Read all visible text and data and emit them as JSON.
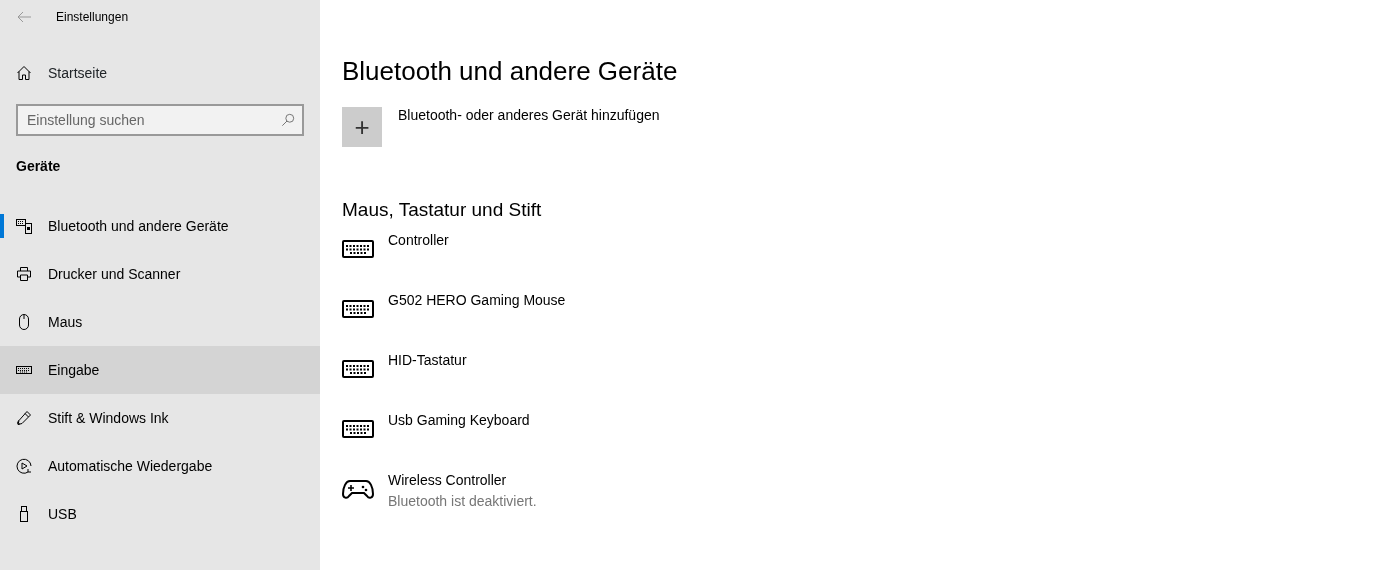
{
  "window": {
    "title": "Einstellungen"
  },
  "sidebar": {
    "home": "Startseite",
    "search": {
      "placeholder": "Einstellung suchen"
    },
    "section": "Geräte",
    "items": [
      {
        "label": "Bluetooth und andere Geräte",
        "kind": "bluetooth",
        "selected": true,
        "hovered": false
      },
      {
        "label": "Drucker und Scanner",
        "kind": "printer",
        "selected": false,
        "hovered": false
      },
      {
        "label": "Maus",
        "kind": "mouse",
        "selected": false,
        "hovered": false
      },
      {
        "label": "Eingabe",
        "kind": "keyboard",
        "selected": false,
        "hovered": true
      },
      {
        "label": "Stift & Windows Ink",
        "kind": "pen",
        "selected": false,
        "hovered": false
      },
      {
        "label": "Automatische Wiedergabe",
        "kind": "autoplay",
        "selected": false,
        "hovered": false
      },
      {
        "label": "USB",
        "kind": "usb",
        "selected": false,
        "hovered": false
      }
    ]
  },
  "page": {
    "title": "Bluetooth und andere Geräte",
    "add_button": {
      "label": "Bluetooth- oder anderes Gerät hinzufügen",
      "icon": "+"
    },
    "section": "Maus, Tastatur und Stift",
    "devices": [
      {
        "name": "Controller",
        "kind": "keyboard"
      },
      {
        "name": "G502 HERO Gaming Mouse",
        "kind": "keyboard"
      },
      {
        "name": "HID-Tastatur",
        "kind": "keyboard"
      },
      {
        "name": "Usb Gaming Keyboard",
        "kind": "keyboard"
      },
      {
        "name": "Wireless Controller",
        "kind": "gamepad",
        "status": "Bluetooth ist deaktiviert."
      }
    ]
  }
}
